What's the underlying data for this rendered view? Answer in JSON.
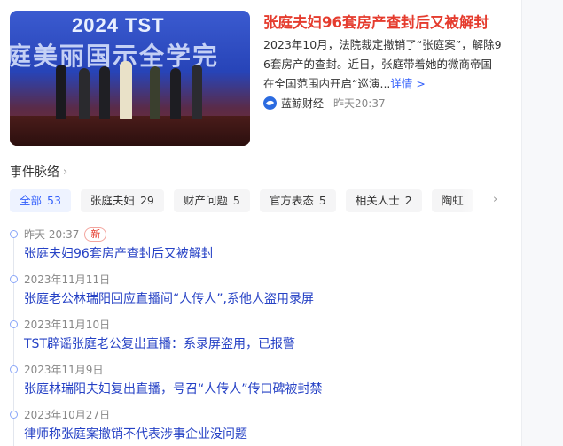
{
  "news": {
    "image_logo_text": "2024 TST",
    "image_banner_text": "庭美丽国示全学完",
    "title": "张庭夫妇96套房产查封后又被解封",
    "summary_line1": "2023年10月，法院裁定撤销了“张庭案”，解除9",
    "summary_line2": "6套房产的查封。近日，张庭带着她的微商帝国",
    "summary_line3": "在全国范围内开启“巡演...",
    "more_link": "详情 >",
    "source_name": "蓝鲸财经",
    "source_time": "昨天20:37"
  },
  "section": {
    "title": "事件脉络"
  },
  "tabs": [
    {
      "label": "全部",
      "count": "53"
    },
    {
      "label": "张庭夫妇",
      "count": "29"
    },
    {
      "label": "财产问题",
      "count": "5"
    },
    {
      "label": "官方表态",
      "count": "5"
    },
    {
      "label": "相关人士",
      "count": "2"
    },
    {
      "label": "陶虹",
      "count": ""
    }
  ],
  "timeline": [
    {
      "date": "昨天 20:37",
      "badge": "新",
      "title": "张庭夫妇96套房产查封后又被解封"
    },
    {
      "date": "2023年11月11日",
      "badge": "",
      "title": "张庭老公林瑞阳回应直播间“人传人”,系他人盗用录屏"
    },
    {
      "date": "2023年11月10日",
      "badge": "",
      "title": "TST辟谣张庭老公复出直播：系录屏盗用，已报警"
    },
    {
      "date": "2023年11月9日",
      "badge": "",
      "title": "张庭林瑞阳夫妇复出直播，号召“人传人”传口碑被封禁"
    },
    {
      "date": "2023年10月27日",
      "badge": "",
      "title": "律师称张庭案撤销不代表涉事企业没问题"
    }
  ],
  "colors": {
    "title_red": "#e53c2e",
    "link_blue": "#315efb",
    "timeline_title_blue": "#2541c5"
  }
}
